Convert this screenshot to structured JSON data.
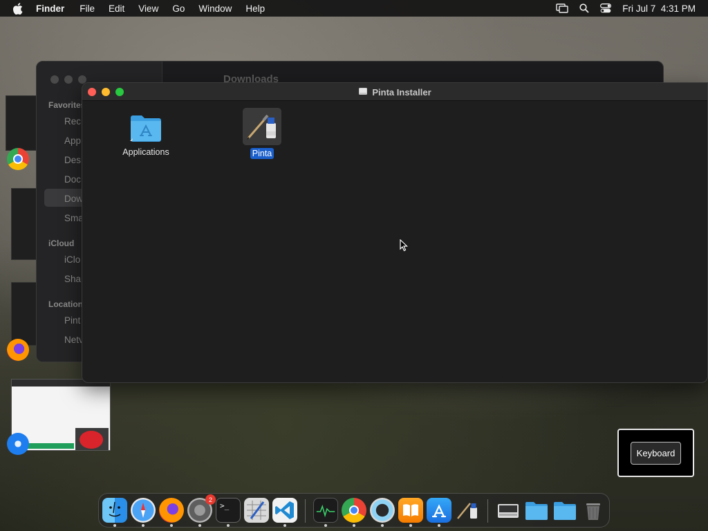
{
  "menubar": {
    "app_name": "Finder",
    "menus": [
      "File",
      "Edit",
      "View",
      "Go",
      "Window",
      "Help"
    ],
    "datetime": "Fri Jul 7  4:31 PM"
  },
  "background_window": {
    "title": "Downloads",
    "sidebar": {
      "sections": [
        {
          "label": "Favorites",
          "items": [
            "Rec",
            "App",
            "Des",
            "Doc",
            "Dow",
            "Sma"
          ]
        },
        {
          "label": "iCloud",
          "items": [
            "iClo",
            "Sha"
          ]
        },
        {
          "label": "Location",
          "items": [
            "Pint",
            "Netv"
          ]
        }
      ],
      "selected": "Dow"
    }
  },
  "installer_window": {
    "title": "Pinta Installer",
    "items": [
      {
        "label": "Applications",
        "icon": "applications-folder-icon",
        "selected": false
      },
      {
        "label": "Pinta",
        "icon": "pinta-app-icon",
        "selected": true
      }
    ]
  },
  "keyboard_overlay": {
    "label": "Keyboard"
  },
  "dock": {
    "apps": [
      {
        "name": "finder-icon",
        "running": true
      },
      {
        "name": "safari-icon",
        "running": true
      },
      {
        "name": "firefox-icon",
        "running": true
      },
      {
        "name": "system-settings-icon",
        "running": true,
        "badge": "2"
      },
      {
        "name": "terminal-icon",
        "running": true
      },
      {
        "name": "script-editor-icon",
        "running": false
      },
      {
        "name": "vscode-icon",
        "running": true
      },
      {
        "name": "activity-monitor-icon",
        "running": true
      },
      {
        "name": "chrome-icon",
        "running": true
      },
      {
        "name": "quicktime-icon",
        "running": true
      },
      {
        "name": "books-icon",
        "running": true
      },
      {
        "name": "app-store-icon",
        "running": true
      },
      {
        "name": "pinta-icon",
        "running": false
      },
      {
        "name": "disk-image-icon",
        "running": false
      },
      {
        "name": "folder-icon",
        "running": false
      },
      {
        "name": "downloads-folder-icon",
        "running": false
      },
      {
        "name": "trash-icon",
        "running": false
      }
    ]
  },
  "colors": {
    "selection": "#1a5fcc",
    "close": "#ff5f57",
    "minimize": "#febc2e",
    "maximize": "#28c840"
  }
}
